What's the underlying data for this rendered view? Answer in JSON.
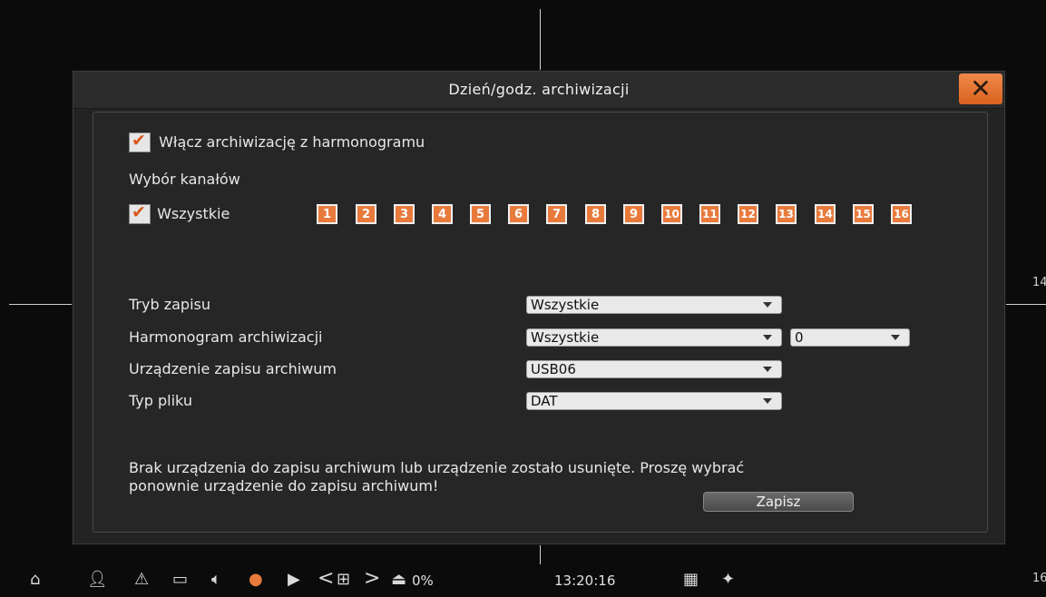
{
  "dialog": {
    "title": "Dzień/godz. archiwizacji",
    "close_icon": "close-icon"
  },
  "schedule": {
    "enable_label": "Włącz archiwizację z harmonogramu",
    "enable_checked": true
  },
  "channels": {
    "section_label": "Wybór kanałów",
    "all_label": "Wszystkie",
    "all_checked": true,
    "items": [
      "1",
      "2",
      "3",
      "4",
      "5",
      "6",
      "7",
      "8",
      "9",
      "10",
      "11",
      "12",
      "13",
      "14",
      "15",
      "16"
    ]
  },
  "fields": {
    "record_mode": {
      "label": "Tryb zapisu",
      "value": "Wszystkie"
    },
    "archive_schedule": {
      "label": "Harmonogram archiwizacji",
      "value": "Wszystkie",
      "secondary_value": "0"
    },
    "archive_device": {
      "label": "Urządzenie zapisu archiwum",
      "value": "USB06"
    },
    "file_type": {
      "label": "Typ pliku",
      "value": "DAT"
    }
  },
  "message": {
    "line1": "Brak urządzenia do zapisu archiwum lub urządzenie zostało usunięte. Proszę wybrać",
    "line2": "ponownie urządzenie do zapisu archiwum!"
  },
  "save_label": "Zapisz",
  "side_numbers": {
    "right_mid": "14",
    "right_bottom": "16"
  },
  "taskbar": {
    "hdd_usage": "0%",
    "time": "13:20:16"
  },
  "colors": {
    "accent": "#e87a3c",
    "dialog_bg": "#232323",
    "close_bg": "#e2722f"
  }
}
